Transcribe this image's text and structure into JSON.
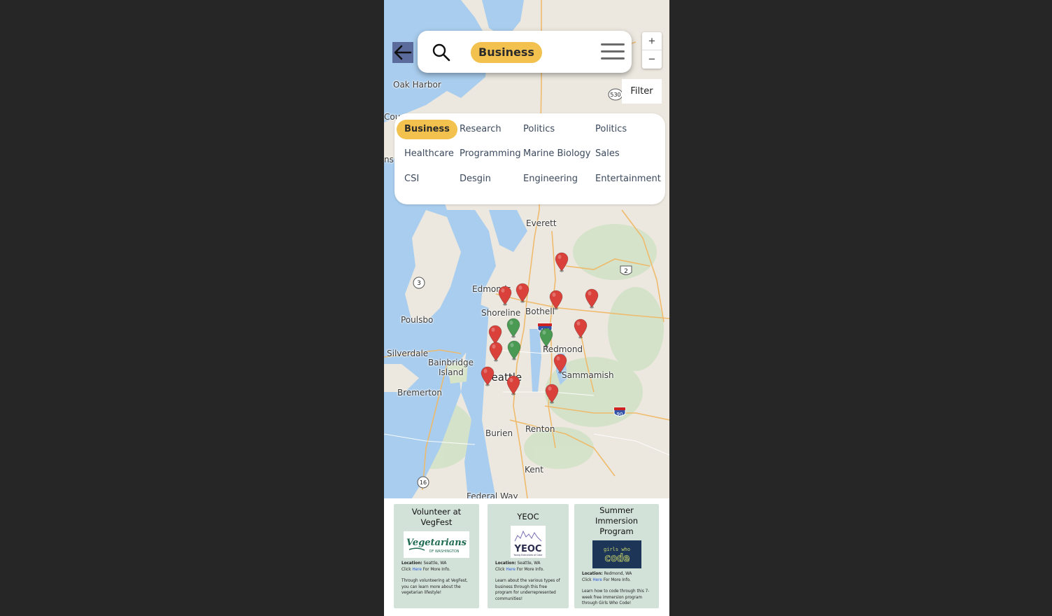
{
  "map": {
    "place_labels": [
      "Oak Harbor",
      "Cou",
      "ns",
      "Everett",
      "Edmonds",
      "Shoreline",
      "Bothell",
      "Poulsbo",
      "Silverdale",
      "Bainbridge",
      "Island",
      "Seattle",
      "Redmond",
      "Sammamish",
      "Bremerton",
      "Renton",
      "Burien",
      "Kent",
      "Federal Way"
    ],
    "road_shields": [
      "530",
      "2",
      "3",
      "405",
      "90",
      "16"
    ],
    "pin_colors": {
      "red": "#d9413a",
      "green": "#4a9a54"
    }
  },
  "search": {
    "back_icon": "arrow-left-icon",
    "search_icon": "search-icon",
    "selected_category": "Business",
    "menu_icon": "hamburger-icon"
  },
  "zoom": {
    "in": "+",
    "out": "−"
  },
  "filter": {
    "label": "Filter",
    "categories": [
      "Business",
      "Research",
      "Politics",
      "Politics",
      "Healthcare",
      "Programming",
      "Marine Biology",
      "Sales",
      "CSI",
      "Desgin",
      "Engineering",
      "Entertainment"
    ],
    "active": "Business"
  },
  "cards": [
    {
      "title_line1": "Volunteer at",
      "title_line2": "VegFest",
      "logo_text": "Vegetarians",
      "logo_sub": "OF WASHINGTON",
      "location_label": "Location:",
      "location": "Seattle, WA",
      "click_pre": "Click",
      "here": "Here",
      "click_post": "For More Info.",
      "desc": "Through volunteering at VegFest, you can learn more about the vegetarian lifestyle!"
    },
    {
      "title_line1": "YEOC",
      "title_line2": "",
      "logo_text": "YEOC",
      "logo_sub": "Young Executives of Color",
      "location_label": "Location:",
      "location": "Seattle, WA",
      "click_pre": "Click",
      "here": "Here",
      "click_post": "For More Info.",
      "desc": "Learn about the various types of business through this free program for underrepresented communities!"
    },
    {
      "title_line1": "Summer Immersion",
      "title_line2": "Program",
      "logo_text": "code",
      "logo_sub": "girls who",
      "location_label": "Location:",
      "location": "Redmond, WA",
      "click_pre": "Click",
      "here": "Here",
      "click_post": "For More Info.",
      "desc": "Learn how to code through this 7-week free immersion program through Girls Who Code!"
    }
  ]
}
